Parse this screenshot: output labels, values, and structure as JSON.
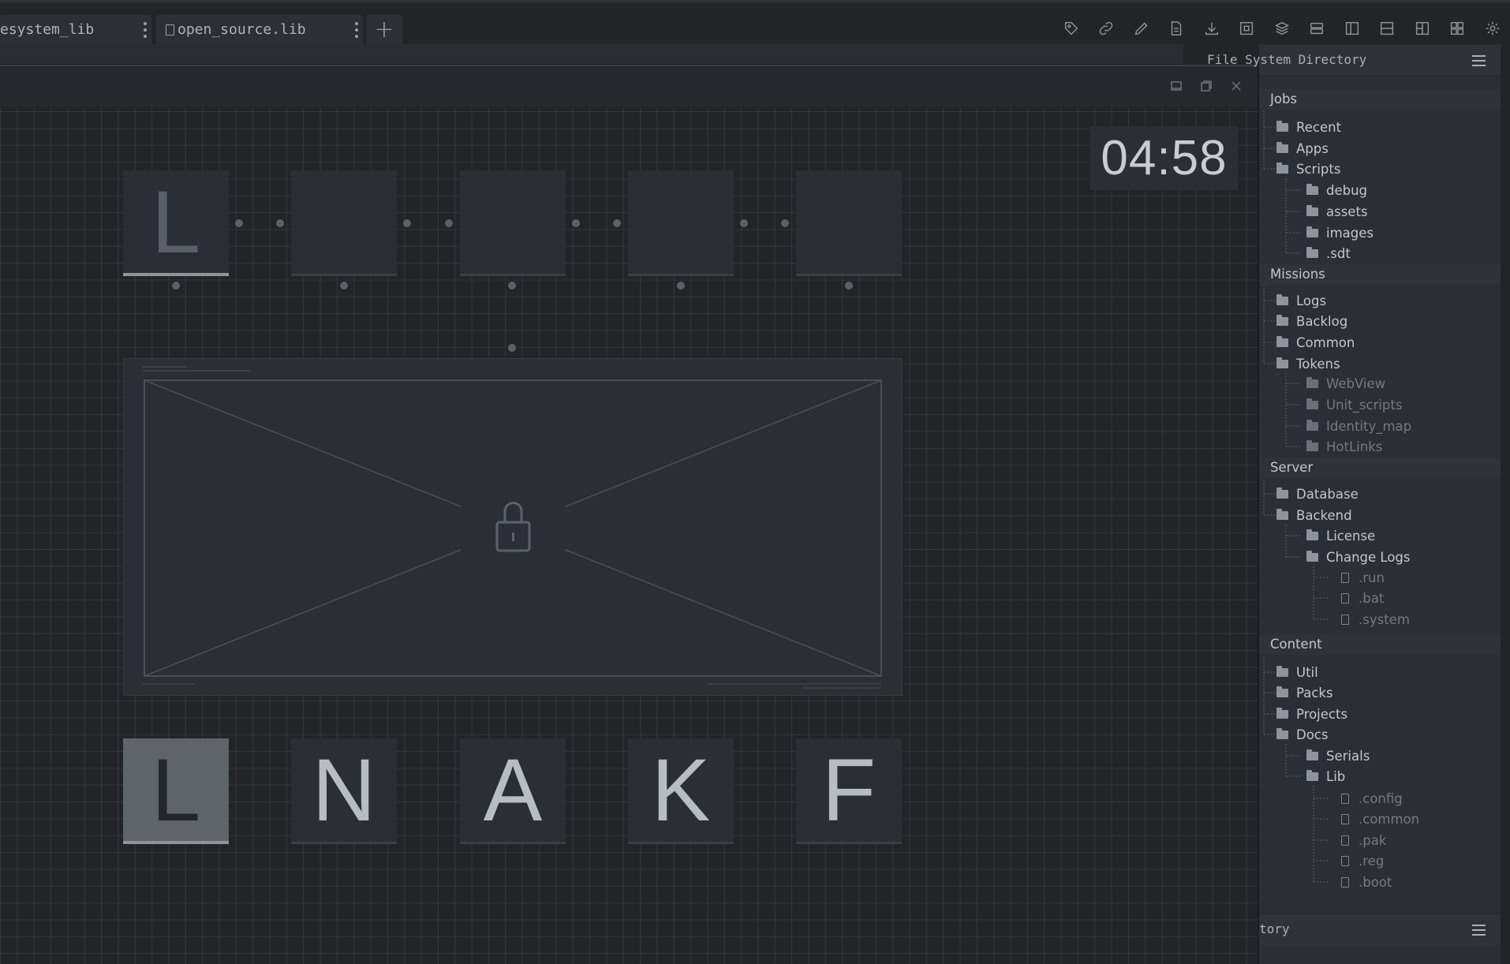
{
  "tabs": [
    {
      "label": "esystem_lib"
    },
    {
      "label": "open_source.lib"
    }
  ],
  "add_tab_label": "+",
  "toolbar_icons": [
    "tag-icon",
    "link-icon",
    "pencil-icon",
    "document-icon",
    "download-icon",
    "frame-icon",
    "layers-icon",
    "rows-icon",
    "sidebar-left-icon",
    "split-horizontal-icon",
    "columns-icon",
    "grid-icon",
    "settings-icon"
  ],
  "game": {
    "timer": "04:58",
    "slots": [
      "L",
      "",
      "",
      "",
      ""
    ],
    "keys": [
      "L",
      "N",
      "A",
      "K",
      "F"
    ],
    "selected_key_index": 0,
    "image_state": "locked"
  },
  "file_tree": {
    "title": "File System Directory",
    "footer_title": "tory",
    "groups": {
      "jobs": {
        "label": "Jobs",
        "items": {
          "recent": "Recent",
          "apps": "Apps",
          "scripts": "Scripts"
        },
        "scripts_children": [
          "debug",
          "assets",
          "images",
          ".sdt"
        ]
      },
      "missions": {
        "label": "Missions",
        "items": {
          "logs": "Logs",
          "backlog": "Backlog",
          "common": "Common",
          "tokens": "Tokens"
        },
        "tokens_children": [
          "WebView",
          "Unit_scripts",
          "Identity_map",
          "HotLinks"
        ]
      },
      "server": {
        "label": "Server",
        "items": {
          "database": "Database",
          "backend": "Backend"
        },
        "backend_children": {
          "license": "License",
          "change_logs": "Change Logs"
        },
        "change_logs_files": [
          ".run",
          ".bat",
          ".system"
        ]
      },
      "content": {
        "label": "Content",
        "items": {
          "util": "Util",
          "packs": "Packs",
          "projects": "Projects",
          "docs": "Docs"
        },
        "docs_children": {
          "serials": "Serials",
          "lib": "Lib"
        },
        "lib_files": [
          ".config",
          ".common",
          ".pak",
          ".reg",
          ".boot"
        ]
      }
    }
  }
}
